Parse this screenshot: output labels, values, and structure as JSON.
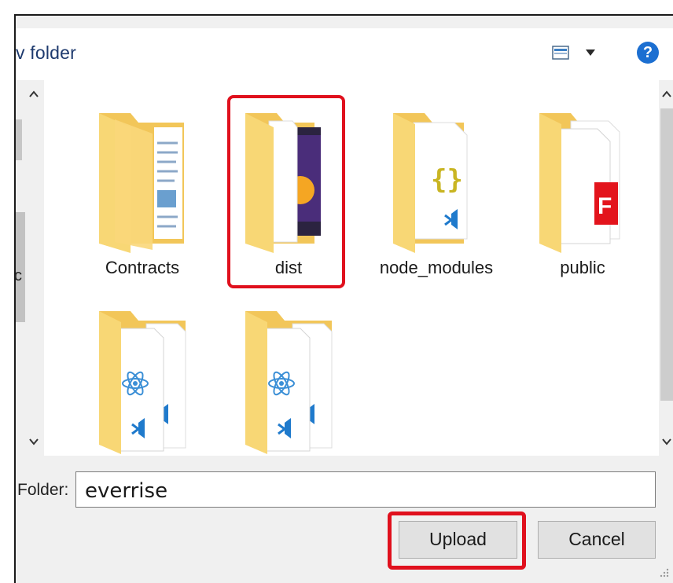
{
  "header": {
    "title": "v folder"
  },
  "items": [
    {
      "label": "Contracts",
      "kind": "docs"
    },
    {
      "label": "dist",
      "kind": "dist"
    },
    {
      "label": "node_modules",
      "kind": "json"
    },
    {
      "label": "public",
      "kind": "pdf"
    },
    {
      "label": "",
      "kind": "react"
    },
    {
      "label": "",
      "kind": "react"
    }
  ],
  "left_pane_text": "c",
  "folder_field": {
    "label": "Folder:",
    "value": "everrise"
  },
  "buttons": {
    "upload": "Upload",
    "cancel": "Cancel"
  },
  "colors": {
    "highlight": "#e0101d",
    "folder": "#f8d775",
    "accent": "#1c6fd1"
  }
}
